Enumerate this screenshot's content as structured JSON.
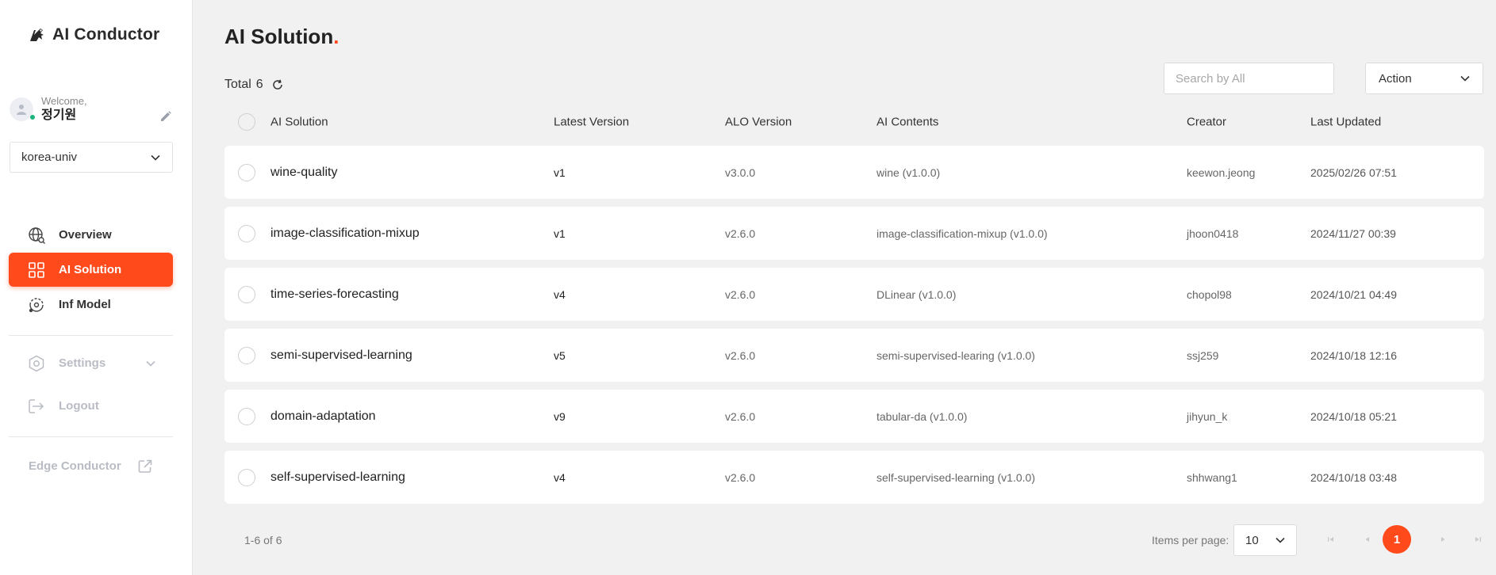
{
  "brand": {
    "name": "AI Conductor"
  },
  "user": {
    "welcome": "Welcome,",
    "name": "정기원"
  },
  "workspace": {
    "selected": "korea-univ"
  },
  "nav": {
    "overview": "Overview",
    "ai_solution": "AI Solution",
    "inf_model": "Inf Model",
    "settings": "Settings",
    "logout": "Logout",
    "edge_conductor": "Edge Conductor"
  },
  "page": {
    "title": "AI Solution",
    "title_dot": "."
  },
  "total": {
    "label": "Total",
    "count": "6"
  },
  "search": {
    "placeholder": "Search by All",
    "value": ""
  },
  "action": {
    "label": "Action"
  },
  "table": {
    "headers": [
      "AI Solution",
      "Latest Version",
      "ALO Version",
      "AI Contents",
      "Creator",
      "Last Updated"
    ],
    "rows": [
      [
        "wine-quality",
        "v1",
        "v3.0.0",
        "wine (v1.0.0)",
        "keewon.jeong",
        "2025/02/26 07:51"
      ],
      [
        "image-classification-mixup",
        "v1",
        "v2.6.0",
        "image-classification-mixup (v1.0.0)",
        "jhoon0418",
        "2024/11/27 00:39"
      ],
      [
        "time-series-forecasting",
        "v4",
        "v2.6.0",
        "DLinear (v1.0.0)",
        "chopol98",
        "2024/10/21 04:49"
      ],
      [
        "semi-supervised-learning",
        "v5",
        "v2.6.0",
        "semi-supervised-learing (v1.0.0)",
        "ssj259",
        "2024/10/18 12:16"
      ],
      [
        "domain-adaptation",
        "v9",
        "v2.6.0",
        "tabular-da (v1.0.0)",
        "jihyun_k",
        "2024/10/18 05:21"
      ],
      [
        "self-supervised-learning",
        "v4",
        "v2.6.0",
        "self-supervised-learning (v1.0.0)",
        "shhwang1",
        "2024/10/18 03:48"
      ]
    ]
  },
  "pagination": {
    "range": "1-6 of 6",
    "items_per_page_label": "Items per page:",
    "items_per_page": "10",
    "current_page": "1"
  },
  "colors": {
    "accent": "#ff4a1c",
    "online": "#1eb37d",
    "background": "#f1f1f1"
  }
}
